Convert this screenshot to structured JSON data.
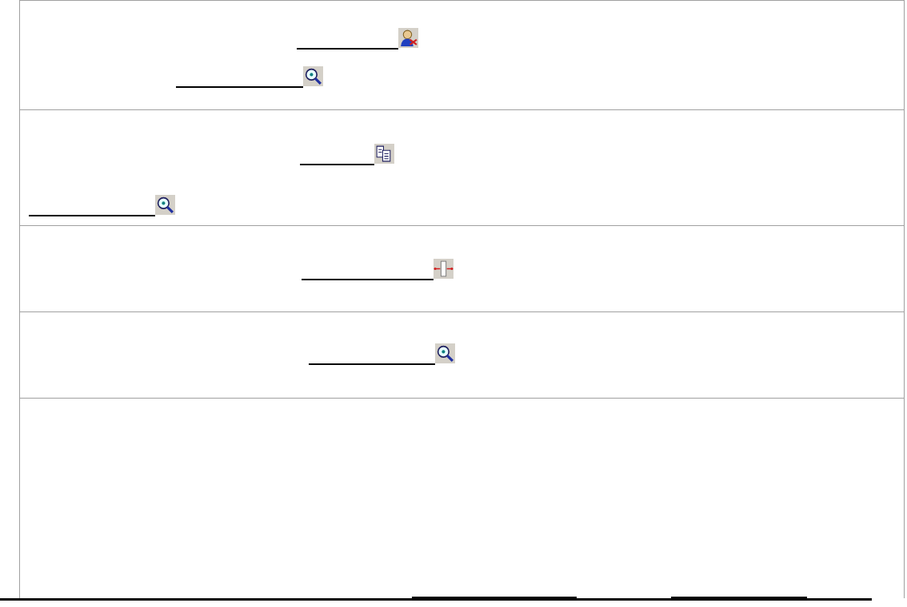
{
  "table": {
    "rows": [
      {
        "lines": [
          {
            "kind": "person"
          },
          {
            "kind": "search"
          }
        ]
      },
      {
        "lines": [
          {
            "kind": "copy"
          },
          {
            "kind": "search"
          }
        ]
      },
      {
        "lines": [
          {
            "kind": "resize"
          }
        ]
      },
      {
        "lines": [
          {
            "kind": "search"
          }
        ]
      },
      {
        "lines": [
          {
            "kind": "plain"
          },
          {
            "kind": "plain"
          }
        ]
      }
    ]
  }
}
